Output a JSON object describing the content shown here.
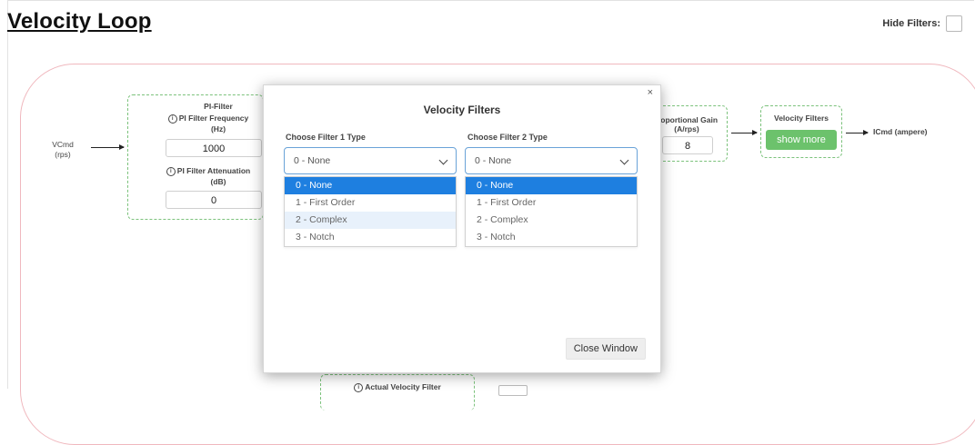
{
  "page": {
    "title": "Velocity Loop",
    "hide_filters_label": "Hide Filters:"
  },
  "diagram": {
    "vcmd_label": "VCmd\n(rps)",
    "pi_filter_title": "PI-Filter",
    "pi_filter_freq_label": "PI Filter Frequency",
    "pi_filter_freq_unit": "(Hz)",
    "pi_filter_freq_value": "1000",
    "pi_filter_atten_label": "PI Filter Attenuation",
    "pi_filter_atten_unit": "(dB)",
    "pi_filter_atten_value": "0",
    "prop_gain_label": "roportional Gain",
    "prop_gain_unit": "(A/rps)",
    "prop_gain_value": "8",
    "velocity_filters_label": "Velocity Filters",
    "show_more_label": "show more",
    "icmd_label": "ICmd (ampere)",
    "actual_velocity_filter_label": "Actual Velocity Filter"
  },
  "modal": {
    "close_glyph": "×",
    "title": "Velocity Filters",
    "filter1_label": "Choose Filter 1 Type",
    "filter1_selected": "0 - None",
    "filter2_label": "Choose Filter 2 Type",
    "filter2_selected": "0 - None",
    "options": [
      "0 - None",
      "1 - First Order",
      "2 - Complex",
      "3 - Notch"
    ],
    "close_window_label": "Close Window"
  }
}
